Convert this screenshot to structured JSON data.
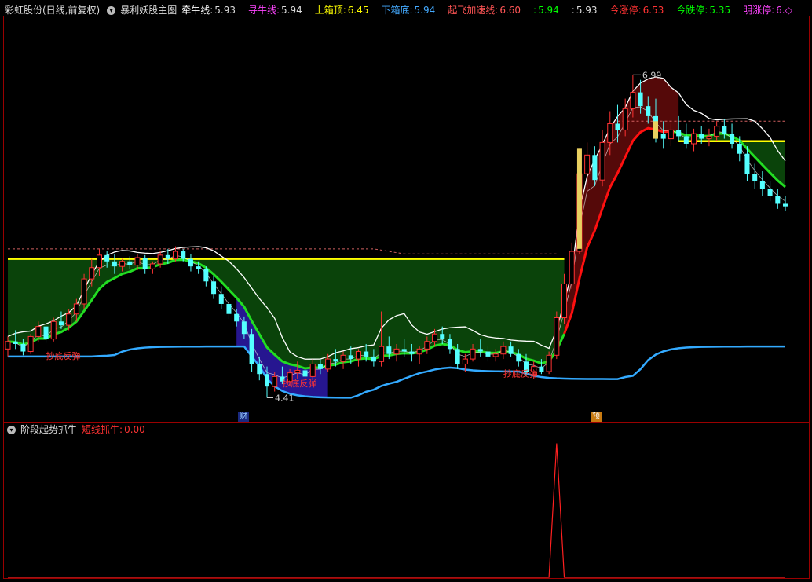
{
  "header": {
    "stock_name": "彩虹股份(日线,前复权)",
    "indicator_name": "暴利妖股主图",
    "items": [
      {
        "label": "牵牛线:",
        "value": "5.93",
        "color": "#ffffff"
      },
      {
        "label": "寻牛线:",
        "value": "5.94",
        "color": "#ff44ff"
      },
      {
        "label": "上箱顶:",
        "value": "6.45",
        "color": "#ffff00"
      },
      {
        "label": "下箱底:",
        "value": "5.94",
        "color": "#44aaff"
      },
      {
        "label": "起飞加速线:",
        "value": "6.60",
        "color": "#ff5555"
      },
      {
        "label": ":",
        "value": "5.94",
        "color": "#00ff00"
      },
      {
        "label": ":",
        "value": "5.93",
        "color": "#ffffff"
      },
      {
        "label": "今涨停:",
        "value": "6.53",
        "color": "#ff3333"
      },
      {
        "label": "今跌停:",
        "value": "5.35",
        "color": "#00ff00"
      },
      {
        "label": "明涨停:",
        "value": "6.◇",
        "color": "#ff44ff"
      }
    ]
  },
  "sub_header": {
    "indicator_name": "阶段起势抓牛",
    "item_label": "短线抓牛:",
    "item_value": "0.00"
  },
  "annotations": {
    "high_label": "6.99",
    "low_label": "4.41",
    "signal_label": "抄底反弹",
    "marker_cai": "财",
    "marker_yu": "预"
  },
  "colors": {
    "up": "#ff3333",
    "down": "#54ffff",
    "box_top": "#ffff00",
    "box_bottom": "#33aaff",
    "green_line": "#22dd22",
    "red_line": "#ff1010",
    "fill_green": "#0b4a0b",
    "fill_red": "#5a0a0a",
    "fill_blue": "#2a18a0",
    "frame": "#9a0000"
  },
  "chart_data": [
    {
      "type": "candlestick",
      "title": "暴利妖股主图",
      "candles": [
        [
          4.8,
          4.9,
          4.74,
          4.86
        ],
        [
          4.86,
          4.95,
          4.8,
          4.84
        ],
        [
          4.84,
          4.88,
          4.75,
          4.78
        ],
        [
          4.78,
          4.92,
          4.76,
          4.9
        ],
        [
          4.9,
          5.02,
          4.86,
          4.98
        ],
        [
          4.98,
          5.0,
          4.85,
          4.88
        ],
        [
          4.88,
          5.05,
          4.86,
          5.02
        ],
        [
          5.02,
          5.1,
          4.96,
          4.99
        ],
        [
          4.99,
          5.12,
          4.95,
          5.08
        ],
        [
          5.08,
          5.2,
          5.02,
          5.16
        ],
        [
          5.16,
          5.4,
          5.12,
          5.36
        ],
        [
          5.36,
          5.52,
          5.3,
          5.45
        ],
        [
          5.45,
          5.6,
          5.38,
          5.55
        ],
        [
          5.55,
          5.58,
          5.45,
          5.5
        ],
        [
          5.5,
          5.56,
          5.4,
          5.46
        ],
        [
          5.46,
          5.52,
          5.42,
          5.5
        ],
        [
          5.5,
          5.54,
          5.44,
          5.47
        ],
        [
          5.47,
          5.56,
          5.43,
          5.53
        ],
        [
          5.53,
          5.55,
          5.4,
          5.44
        ],
        [
          5.44,
          5.5,
          5.4,
          5.48
        ],
        [
          5.48,
          5.58,
          5.45,
          5.55
        ],
        [
          5.55,
          5.6,
          5.48,
          5.52
        ],
        [
          5.52,
          5.62,
          5.5,
          5.58
        ],
        [
          5.58,
          5.6,
          5.5,
          5.52
        ],
        [
          5.52,
          5.56,
          5.42,
          5.46
        ],
        [
          5.46,
          5.5,
          5.4,
          5.44
        ],
        [
          5.44,
          5.46,
          5.3,
          5.34
        ],
        [
          5.34,
          5.38,
          5.2,
          5.24
        ],
        [
          5.24,
          5.3,
          5.12,
          5.16
        ],
        [
          5.16,
          5.2,
          5.04,
          5.08
        ],
        [
          5.08,
          5.12,
          4.98,
          5.02
        ],
        [
          5.02,
          5.06,
          4.88,
          4.92
        ],
        [
          4.92,
          4.96,
          4.62,
          4.68
        ],
        [
          4.68,
          4.74,
          4.55,
          4.6
        ],
        [
          4.6,
          4.66,
          4.41,
          4.5
        ],
        [
          4.5,
          4.62,
          4.46,
          4.58
        ],
        [
          4.58,
          4.66,
          4.52,
          4.54
        ],
        [
          4.54,
          4.64,
          4.5,
          4.61
        ],
        [
          4.61,
          4.7,
          4.56,
          4.63
        ],
        [
          4.63,
          4.66,
          4.55,
          4.58
        ],
        [
          4.58,
          4.72,
          4.56,
          4.68
        ],
        [
          4.68,
          4.72,
          4.6,
          4.64
        ],
        [
          4.64,
          4.76,
          4.62,
          4.72
        ],
        [
          4.72,
          4.8,
          4.66,
          4.7
        ],
        [
          4.7,
          4.78,
          4.64,
          4.75
        ],
        [
          4.75,
          4.82,
          4.68,
          4.72
        ],
        [
          4.72,
          4.8,
          4.66,
          4.78
        ],
        [
          4.78,
          4.84,
          4.7,
          4.74
        ],
        [
          4.74,
          4.8,
          4.66,
          4.7
        ],
        [
          4.7,
          5.1,
          4.66,
          4.82
        ],
        [
          4.82,
          4.9,
          4.72,
          4.76
        ],
        [
          4.76,
          4.84,
          4.7,
          4.8
        ],
        [
          4.8,
          4.88,
          4.74,
          4.78
        ],
        [
          4.78,
          4.84,
          4.7,
          4.76
        ],
        [
          4.76,
          4.82,
          4.68,
          4.8
        ],
        [
          4.8,
          4.9,
          4.76,
          4.86
        ],
        [
          4.86,
          4.96,
          4.82,
          4.92
        ],
        [
          4.92,
          4.98,
          4.84,
          4.88
        ],
        [
          4.88,
          4.92,
          4.76,
          4.8
        ],
        [
          4.8,
          4.84,
          4.64,
          4.68
        ],
        [
          4.68,
          4.76,
          4.62,
          4.72
        ],
        [
          4.72,
          4.84,
          4.7,
          4.8
        ],
        [
          4.8,
          4.88,
          4.74,
          4.78
        ],
        [
          4.78,
          4.82,
          4.7,
          4.74
        ],
        [
          4.74,
          4.8,
          4.7,
          4.76
        ],
        [
          4.76,
          4.86,
          4.72,
          4.82
        ],
        [
          4.82,
          4.86,
          4.74,
          4.76
        ],
        [
          4.76,
          4.8,
          4.66,
          4.7
        ],
        [
          4.7,
          4.76,
          4.58,
          4.62
        ],
        [
          4.62,
          4.7,
          4.56,
          4.66
        ],
        [
          4.66,
          4.72,
          4.6,
          4.62
        ],
        [
          4.62,
          4.78,
          4.6,
          4.75
        ],
        [
          4.75,
          5.1,
          4.72,
          5.05
        ],
        [
          5.05,
          5.4,
          5.0,
          5.32
        ],
        [
          5.32,
          5.65,
          5.28,
          5.58
        ],
        [
          5.58,
          6.4,
          5.56,
          6.2
        ],
        [
          6.2,
          6.45,
          6.05,
          6.35
        ],
        [
          6.35,
          6.42,
          6.1,
          6.15
        ],
        [
          6.15,
          6.55,
          6.1,
          6.45
        ],
        [
          6.45,
          6.7,
          6.35,
          6.6
        ],
        [
          6.6,
          6.75,
          6.45,
          6.55
        ],
        [
          6.55,
          6.8,
          6.5,
          6.72
        ],
        [
          6.72,
          6.99,
          6.65,
          6.85
        ],
        [
          6.85,
          6.95,
          6.68,
          6.74
        ],
        [
          6.74,
          6.82,
          6.6,
          6.66
        ],
        [
          6.66,
          6.8,
          6.45,
          6.52
        ],
        [
          6.52,
          6.62,
          6.4,
          6.48
        ],
        [
          6.48,
          6.6,
          6.42,
          6.55
        ],
        [
          6.55,
          6.66,
          6.46,
          6.5
        ],
        [
          6.5,
          6.6,
          6.4,
          6.44
        ],
        [
          6.44,
          6.56,
          6.38,
          6.52
        ],
        [
          6.52,
          6.58,
          6.44,
          6.48
        ],
        [
          6.48,
          6.56,
          6.42,
          6.5
        ],
        [
          6.5,
          6.62,
          6.46,
          6.58
        ],
        [
          6.58,
          6.64,
          6.48,
          6.52
        ],
        [
          6.52,
          6.6,
          6.4,
          6.44
        ],
        [
          6.44,
          6.5,
          6.3,
          6.36
        ],
        [
          6.36,
          6.42,
          6.14,
          6.2
        ],
        [
          6.2,
          6.28,
          6.08,
          6.14
        ],
        [
          6.14,
          6.22,
          6.02,
          6.08
        ],
        [
          6.08,
          6.14,
          5.98,
          6.02
        ],
        [
          6.02,
          6.08,
          5.92,
          5.96
        ],
        [
          5.96,
          6.02,
          5.9,
          5.94
        ]
      ],
      "box_top": 5.52,
      "box_bottom": 4.82,
      "high": 6.99,
      "low": 4.41,
      "ylim": [
        4.25,
        7.45
      ]
    },
    {
      "type": "line",
      "title": "阶段起势抓牛",
      "series": [
        {
          "name": "短线抓牛",
          "values": [
            0,
            0,
            0,
            0,
            0,
            0,
            0,
            0,
            0,
            0,
            0,
            0,
            0,
            0,
            0,
            0,
            0,
            0,
            0,
            0,
            0,
            0,
            0,
            0,
            0,
            0,
            0,
            0,
            0,
            0,
            0,
            0,
            0,
            0,
            0,
            0,
            0,
            0,
            0,
            0,
            0,
            0,
            0,
            0,
            0,
            0,
            0,
            0,
            0,
            0,
            0,
            0,
            0,
            0,
            0,
            0,
            0,
            0,
            0,
            0,
            0,
            0,
            0,
            0,
            0,
            0,
            0,
            0,
            0,
            0,
            0,
            0,
            100,
            0,
            0,
            0,
            0,
            0,
            0,
            0,
            0,
            0,
            0,
            0,
            0,
            0,
            0,
            0,
            0,
            0,
            0,
            0,
            0,
            0,
            0,
            0,
            0,
            0,
            0,
            0,
            0,
            0,
            0
          ]
        }
      ],
      "ylim": [
        0,
        105
      ]
    }
  ]
}
